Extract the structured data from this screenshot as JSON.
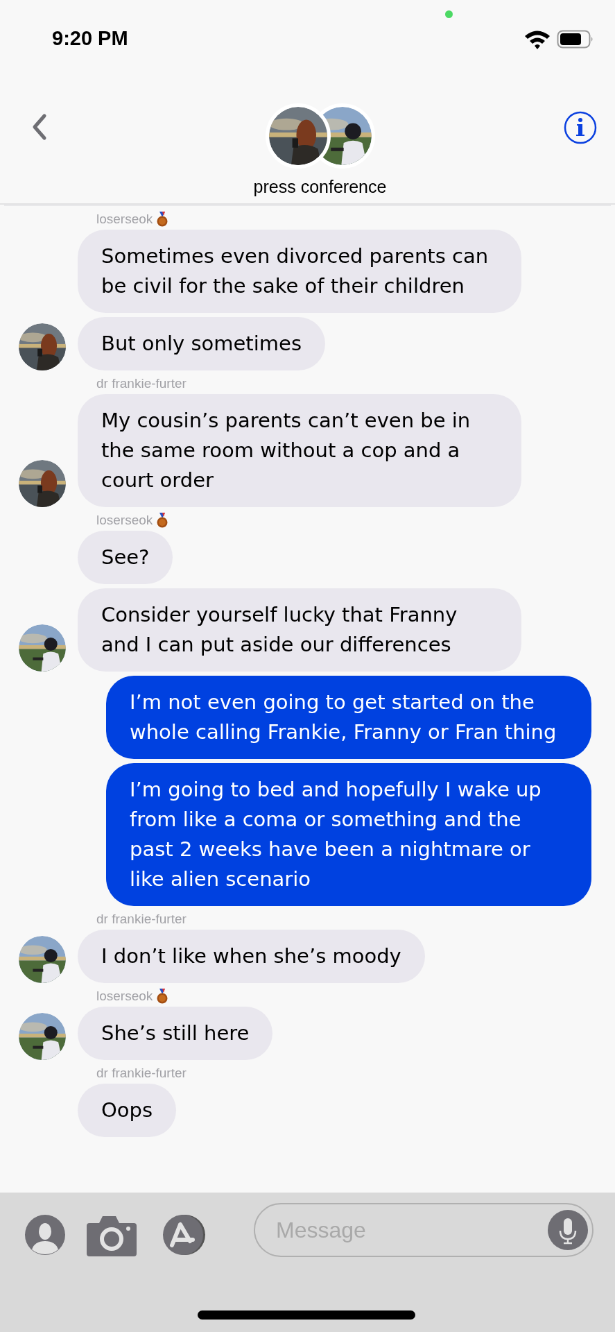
{
  "status_bar": {
    "time": "9:20 PM",
    "privacy_dot": true
  },
  "header": {
    "title": "press conference"
  },
  "messages": [
    {
      "kind": "sender",
      "name": "loserseok",
      "medal": true
    },
    {
      "kind": "incoming",
      "text": "Sometimes even divorced parents can be civil for the sake of their children",
      "avatar": false
    },
    {
      "kind": "incoming",
      "text": "But only sometimes",
      "avatar": true
    },
    {
      "kind": "sender",
      "name": "dr frankie-furter",
      "medal": false
    },
    {
      "kind": "incoming",
      "text": "My cousin’s parents can’t even be in the same room without a cop and a court order",
      "avatar": true
    },
    {
      "kind": "sender",
      "name": "loserseok",
      "medal": true
    },
    {
      "kind": "incoming",
      "text": "See?",
      "avatar": false
    },
    {
      "kind": "incoming",
      "text": "Consider yourself lucky that Franny and I can put aside our differences",
      "avatar": true
    },
    {
      "kind": "outgoing",
      "text": "I’m not even going to get started on the whole calling Frankie, Franny or Fran thing"
    },
    {
      "kind": "outgoing",
      "text": "I’m going to bed and hopefully I wake up from like a coma or something and the past 2 weeks have been a nightmare or like alien scenario"
    },
    {
      "kind": "sender",
      "name": "dr frankie-furter",
      "medal": false
    },
    {
      "kind": "incoming",
      "text": "I don’t like when she’s moody",
      "avatar": true
    },
    {
      "kind": "sender",
      "name": "loserseok",
      "medal": true
    },
    {
      "kind": "incoming",
      "text": "She’s still here",
      "avatar": true
    },
    {
      "kind": "sender",
      "name": "dr frankie-furter",
      "medal": false
    },
    {
      "kind": "incoming",
      "text": "Oops",
      "avatar": false
    }
  ],
  "composer": {
    "placeholder": "Message"
  }
}
